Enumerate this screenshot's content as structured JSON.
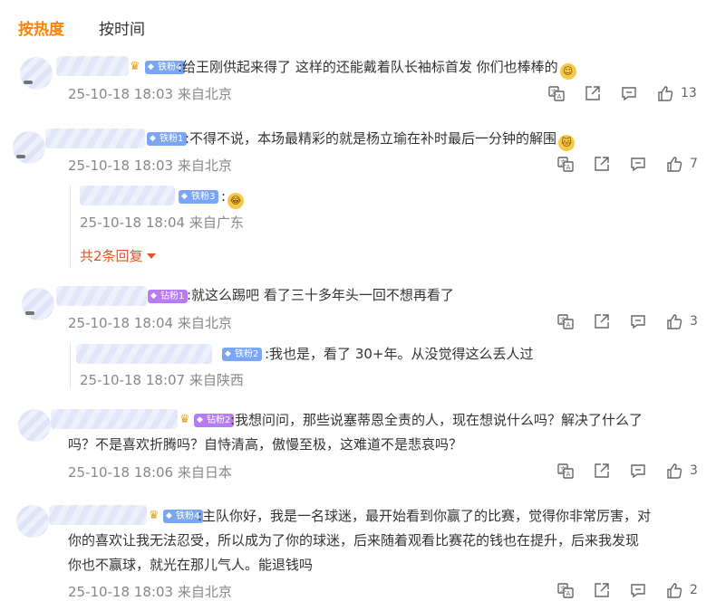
{
  "tabs": {
    "hot": "按热度",
    "time": "按时间"
  },
  "comments": [
    {
      "badge": "铁粉4",
      "badge_type": "iron",
      "crown": true,
      "text": ":给王刚供起来得了 这样的还能戴着队长袖标首发 你们也棒棒的",
      "emoji": "☺",
      "meta": "25-10-18 18:03 来自北京",
      "likes": "13"
    },
    {
      "badge": "铁粉1",
      "badge_type": "iron",
      "crown": false,
      "text": ":不得不说，本场最精彩的就是杨立瑜在补时最后一分钟的解围",
      "emoji": "🐱",
      "meta": "25-10-18 18:03 来自北京",
      "likes": "7",
      "reply": {
        "badge": "铁粉3",
        "text": ":",
        "emoji": "😂",
        "meta": "25-10-18 18:04 来自广东"
      },
      "more": "共2条回复"
    },
    {
      "badge": "钻粉1",
      "badge_type": "diamond",
      "crown": false,
      "text": ":就这么踢吧 看了三十多年头一回不想再看了",
      "meta": "25-10-18 18:04 来自北京",
      "likes": "3",
      "reply": {
        "badge": "铁粉2",
        "text": ":我也是，看了 30+年。从没觉得这么丢人过",
        "meta": "25-10-18 18:07 来自陕西"
      }
    },
    {
      "badge": "钻粉2",
      "badge_type": "diamond",
      "crown": true,
      "line1": ":我想问问，那些说塞蒂恩全责的人，现在想说什么吗？解决了什么了",
      "line2": "吗？不是喜欢折腾吗？自恃清高，傲慢至极，这难道不是悲哀吗？",
      "meta": "25-10-18 18:06 来自日本",
      "likes": "3"
    },
    {
      "badge": "铁粉4",
      "badge_type": "iron",
      "crown": true,
      "line1": ":主队你好，我是一名球迷，最开始看到你赢了的比赛，觉得你非常厉害，对",
      "line2": "你的喜欢让我无法忍受，所以成为了你的球迷，后来随着观看比赛花的钱也在提升，后来我发现",
      "line3": "你也不赢球，就光在那儿气人。能退钱吗",
      "meta": "25-10-18 18:03 来自北京",
      "likes": "2"
    }
  ]
}
